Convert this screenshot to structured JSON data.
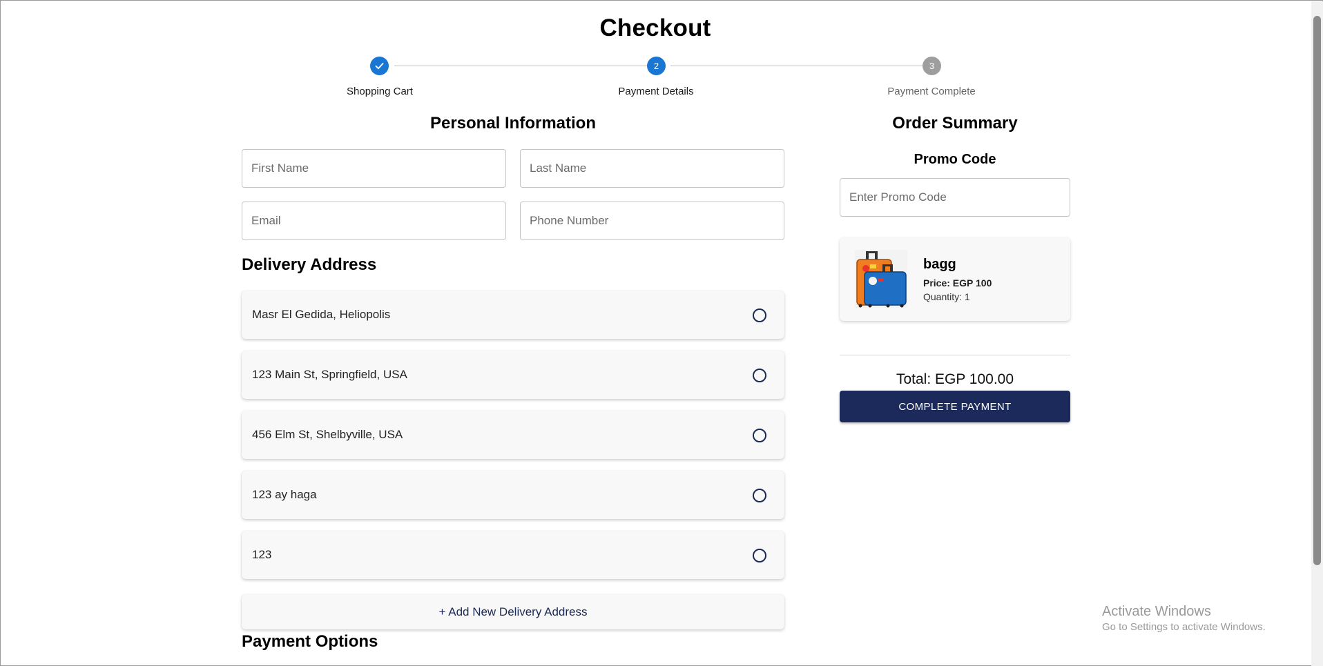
{
  "page": {
    "title": "Checkout",
    "accent_color": "#1976d2",
    "primary_color": "#1b2a5b"
  },
  "stepper": {
    "steps": [
      {
        "label": "Shopping Cart",
        "state": "completed",
        "icon": "check-icon"
      },
      {
        "label": "Payment Details",
        "state": "active",
        "number": "2"
      },
      {
        "label": "Payment Complete",
        "state": "inactive",
        "number": "3"
      }
    ]
  },
  "personal": {
    "heading": "Personal Information",
    "first_name": {
      "placeholder": "First Name",
      "value": ""
    },
    "last_name": {
      "placeholder": "Last Name",
      "value": ""
    },
    "email": {
      "placeholder": "Email",
      "value": ""
    },
    "phone": {
      "placeholder": "Phone Number",
      "value": ""
    }
  },
  "delivery": {
    "heading": "Delivery Address",
    "addresses": [
      {
        "text": "Masr El Gedida, Heliopolis",
        "selected": false
      },
      {
        "text": "123 Main St, Springfield, USA",
        "selected": false
      },
      {
        "text": "456 Elm St, Shelbyville, USA",
        "selected": false
      },
      {
        "text": "123 ay haga",
        "selected": false
      },
      {
        "text": "123",
        "selected": false
      }
    ],
    "add_label": "+ Add New Delivery Address"
  },
  "payment_options": {
    "heading": "Payment Options"
  },
  "summary": {
    "heading": "Order Summary",
    "promo_heading": "Promo Code",
    "promo": {
      "placeholder": "Enter Promo Code",
      "value": ""
    },
    "item": {
      "name": "bagg",
      "price": "Price: EGP 100",
      "quantity": "Quantity: 1",
      "image_icon": "luggage-image"
    },
    "total": "Total: EGP 100.00",
    "pay_button": "COMPLETE PAYMENT"
  },
  "watermark": {
    "line1": "Activate Windows",
    "line2": "Go to Settings to activate Windows."
  }
}
